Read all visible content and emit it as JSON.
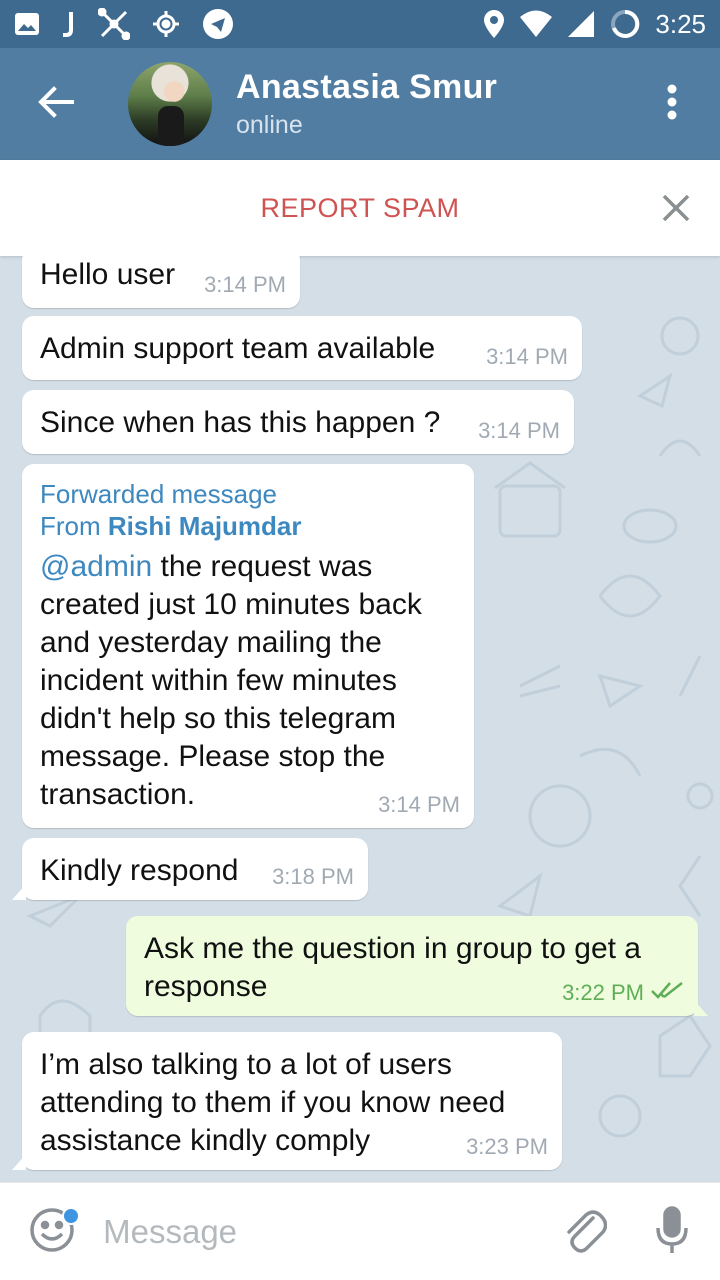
{
  "status_bar": {
    "time": "3:25",
    "left_icons": [
      "image-icon",
      "j-icon",
      "network-icon",
      "location-target-icon",
      "telegram-icon"
    ],
    "right_icons": [
      "location-pin-icon",
      "wifi-icon",
      "signal-icon",
      "battery-ring-icon"
    ]
  },
  "header": {
    "contact_name": "Anastasia Smur",
    "contact_status": "online"
  },
  "report_bar": {
    "label": "REPORT SPAM"
  },
  "messages": [
    {
      "direction": "in",
      "text": "Hello user",
      "time": "3:14 PM"
    },
    {
      "direction": "in",
      "text": "Admin support team available",
      "time": "3:14 PM"
    },
    {
      "direction": "in",
      "text": "Since when has this happen ?",
      "time": "3:14 PM"
    },
    {
      "direction": "in",
      "forwarded_label": "Forwarded message",
      "from_prefix": "From",
      "from_name": "Rishi Majumdar",
      "mention": "@admin",
      "text_after_mention": " the request was created just 10 minutes back and yesterday mailing the incident within few minutes didn't help so this telegram message. Please stop the transaction.",
      "time": "3:14 PM"
    },
    {
      "direction": "in",
      "text": "Kindly respond",
      "time": "3:18 PM"
    },
    {
      "direction": "out",
      "text": "Ask me the question in group to get a response",
      "time": "3:22 PM",
      "status": "read"
    },
    {
      "direction": "in",
      "text": "I’m also talking to a lot of users attending to them if you know need assistance kindly comply",
      "time": "3:23 PM"
    }
  ],
  "input": {
    "placeholder": "Message"
  },
  "colors": {
    "status_bar": "#3f6a90",
    "header": "#517da2",
    "chat_background": "#d3dee7",
    "report_spam": "#cf5352",
    "link": "#3e88c0",
    "outgoing_bubble": "#effdde",
    "outgoing_time": "#5fae57"
  }
}
